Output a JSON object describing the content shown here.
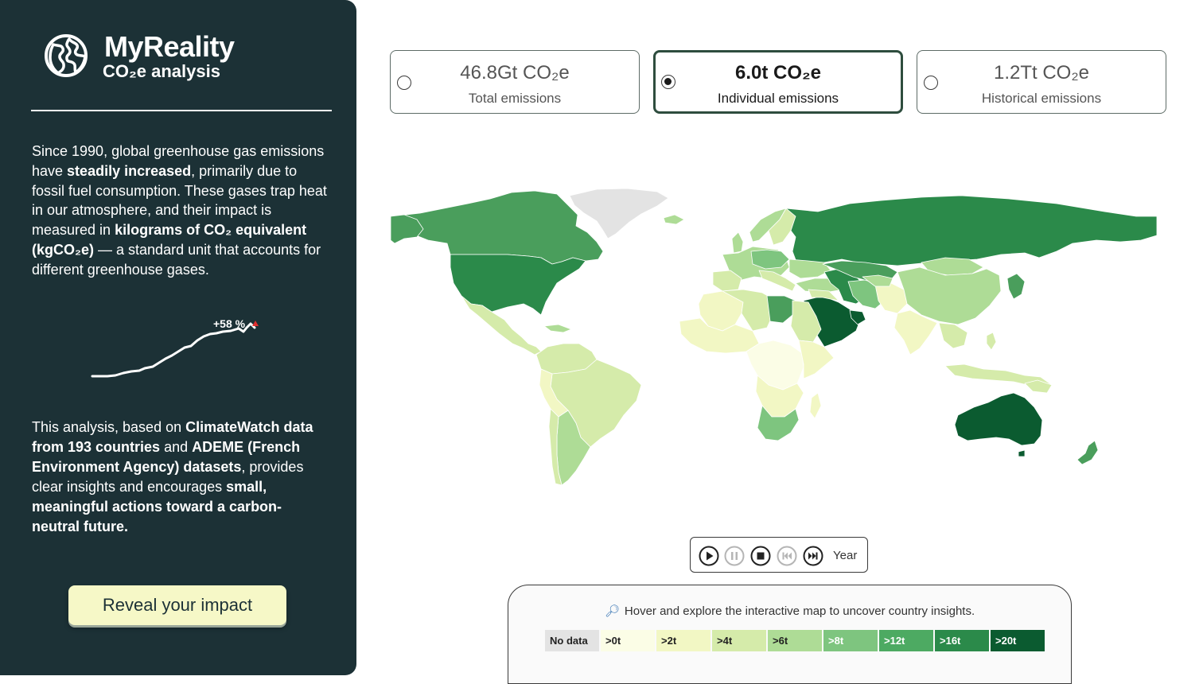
{
  "brand": {
    "title": "MyReality",
    "subtitle": "CO₂e analysis",
    "icon": "globe-icon"
  },
  "sidebar": {
    "intro": [
      {
        "t": "Since 1990, global greenhouse gas emissions have ",
        "b": false
      },
      {
        "t": "steadily increased",
        "b": true
      },
      {
        "t": ", primarily due to fossil fuel consumption. These gases trap heat in our atmosphere, and their impact is measured in ",
        "b": false
      },
      {
        "t": "kilograms of CO₂ equivalent (kgCO₂e)",
        "b": true
      },
      {
        "t": " — a standard unit that accounts for different greenhouse gases.",
        "b": false
      }
    ],
    "trend_label": "+58 %",
    "analysis": [
      {
        "t": "This analysis, based on ",
        "b": false
      },
      {
        "t": "ClimateWatch data from 193 countries",
        "b": true
      },
      {
        "t": " and ",
        "b": false
      },
      {
        "t": "ADEME (French Environment Agency) datasets",
        "b": true
      },
      {
        "t": ", provides clear insights and encourages ",
        "b": false
      },
      {
        "t": "small, meaningful actions toward a carbon-neutral future.",
        "b": true
      }
    ],
    "cta_label": "Reveal your impact"
  },
  "cards": [
    {
      "value": "46.8Gt CO₂e",
      "label": "Total emissions",
      "selected": false
    },
    {
      "value": "6.0t CO₂e",
      "label": "Individual emissions",
      "selected": true
    },
    {
      "value": "1.2Tt CO₂e",
      "label": "Historical emissions",
      "selected": false
    }
  ],
  "playback": {
    "buttons": [
      "play-icon",
      "pause-icon",
      "stop-icon",
      "skip-back-icon",
      "skip-forward-icon"
    ],
    "year_label": "Year"
  },
  "legend": {
    "hint": "Hover and explore the interactive map to uncover country insights.",
    "hint_icon": "magnifier-icon",
    "items": [
      {
        "label": "No data",
        "color": "#e3e3e3",
        "text": "#222222"
      },
      {
        "label": ">0t",
        "color": "#fbfde6",
        "text": "#222222"
      },
      {
        "label": ">2t",
        "color": "#f2f7c4",
        "text": "#222222"
      },
      {
        "label": ">4t",
        "color": "#d5ebaa",
        "text": "#222222"
      },
      {
        "label": ">6t",
        "color": "#aedc96",
        "text": "#222222"
      },
      {
        "label": ">8t",
        "color": "#7ec57f",
        "text": "#ffffff"
      },
      {
        "label": ">12t",
        "color": "#4daa62",
        "text": "#ffffff"
      },
      {
        "label": ">16t",
        "color": "#2b8a4a",
        "text": "#ffffff"
      },
      {
        "label": ">20t",
        "color": "#0b5b30",
        "text": "#ffffff"
      }
    ]
  },
  "colors": {
    "sidebar_bg": "#1c3136",
    "cta_bg": "#f6f8c7",
    "card_selected_border": "#2e4d3e",
    "trend_marker": "#e03030"
  }
}
